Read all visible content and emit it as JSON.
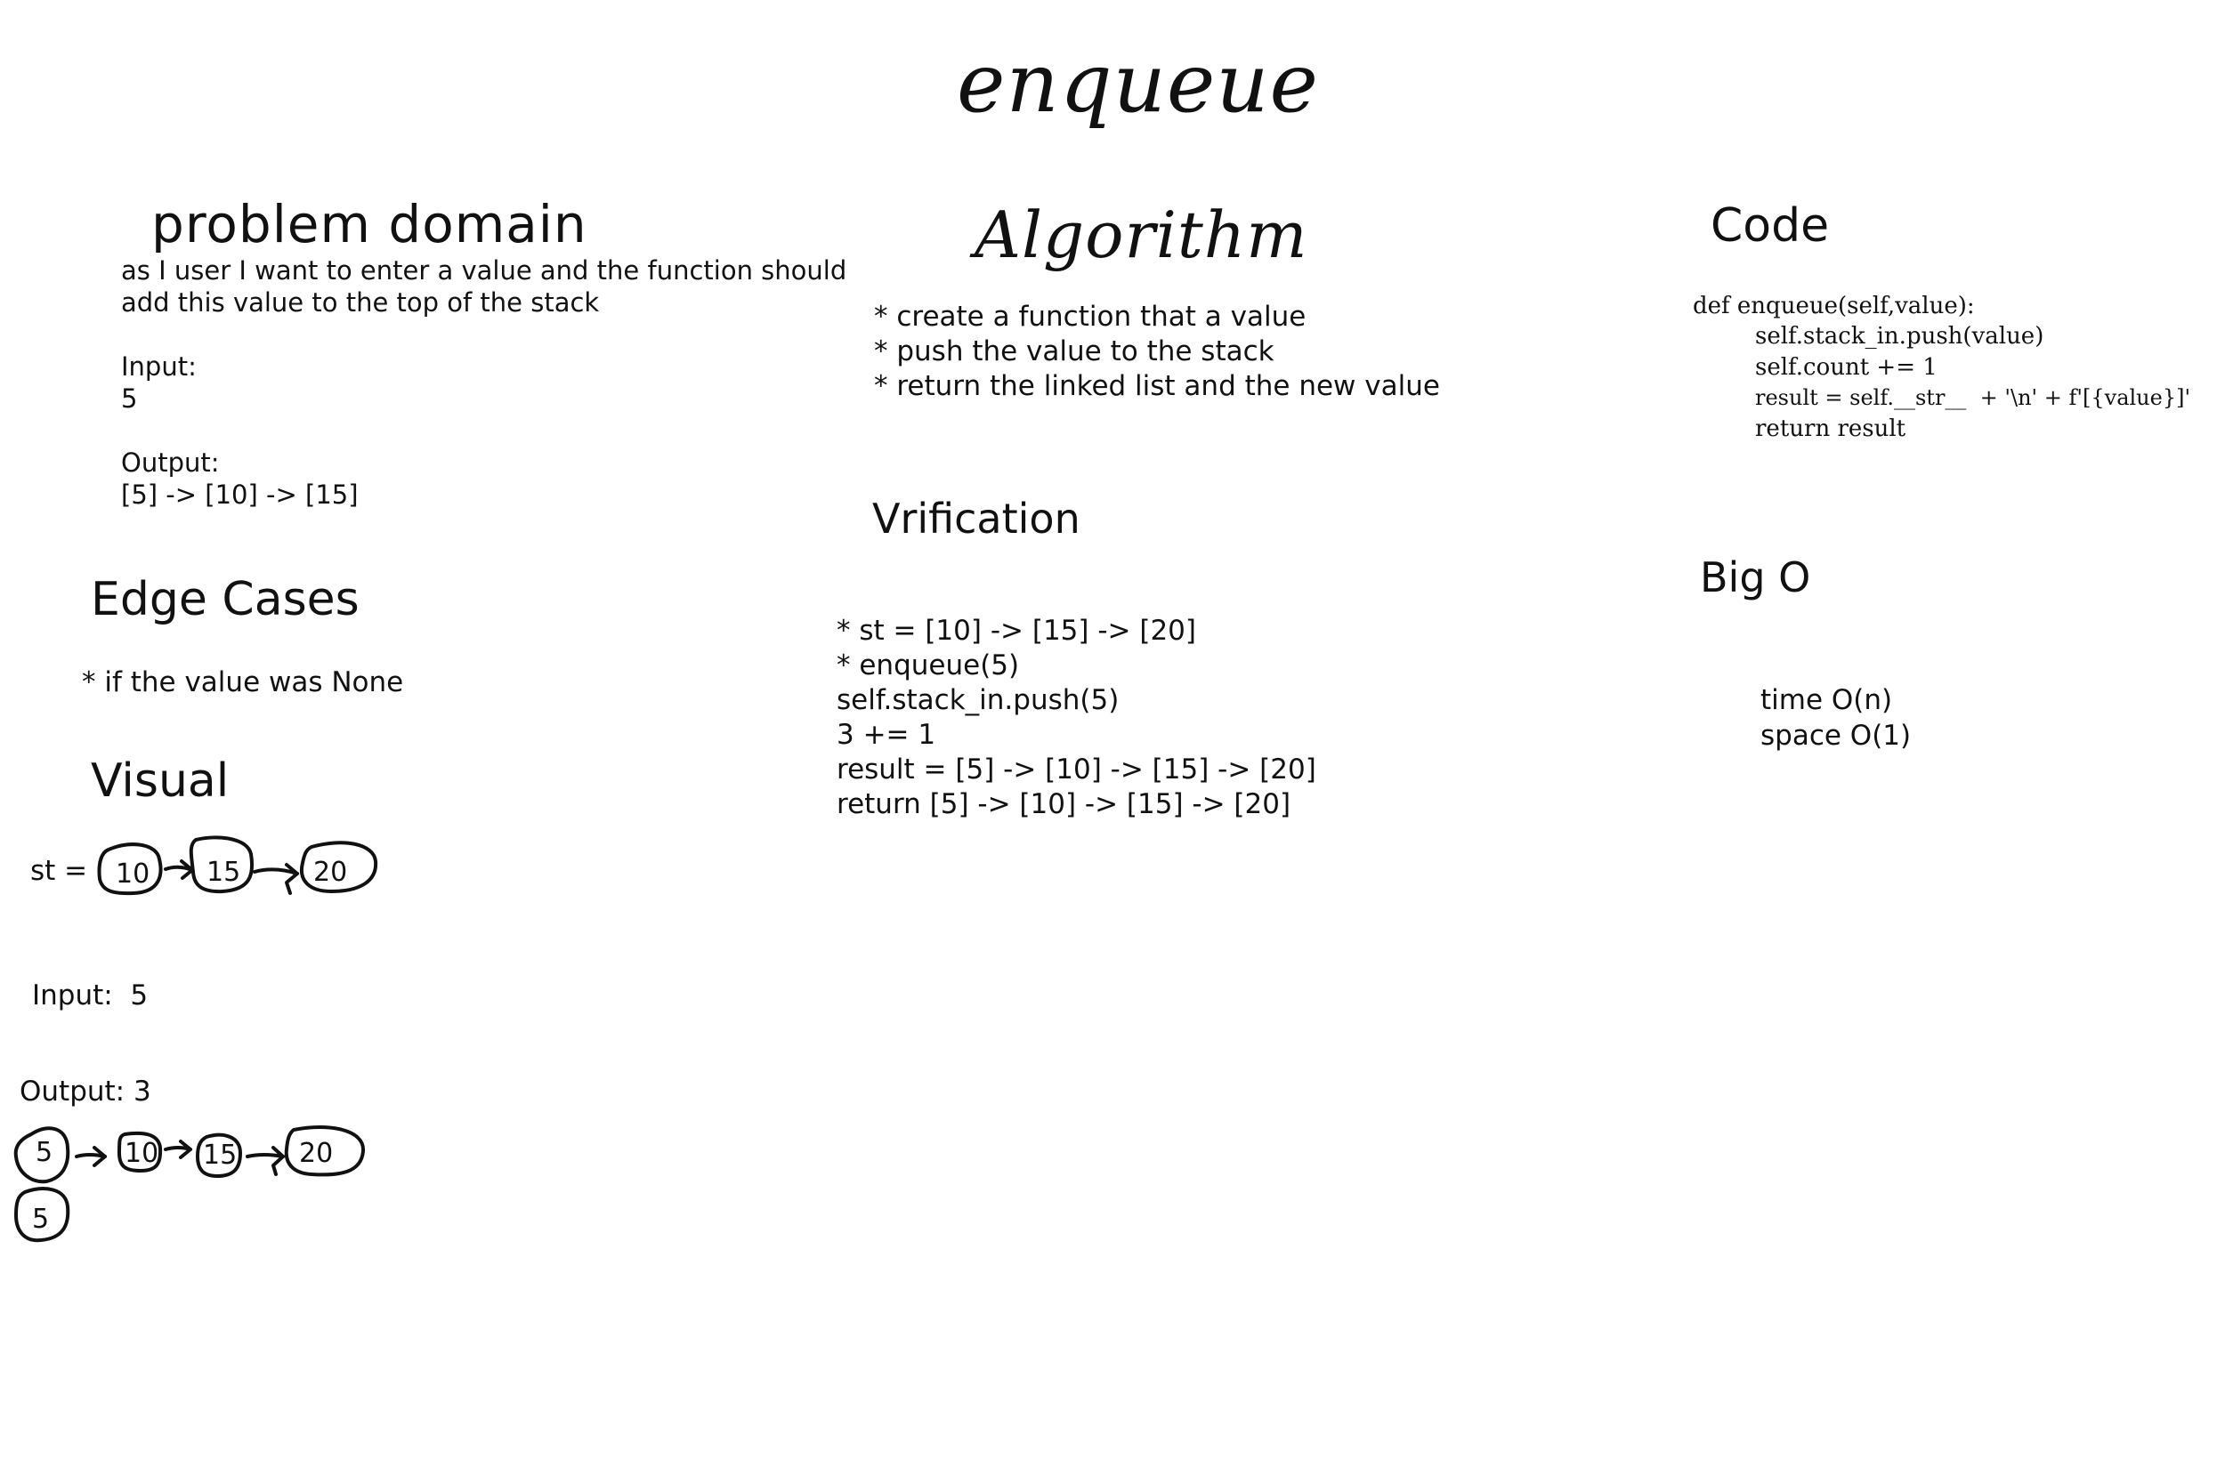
{
  "title": "enqueue",
  "problem_domain": {
    "heading": "problem domain",
    "description": [
      "as I user I want to enter a value and the function should",
      "add this value to the top of the stack"
    ],
    "input_label": "Input:",
    "input_value": "5",
    "output_label": "Output:",
    "output_value": "[5] -> [10] -> [15]"
  },
  "edge_cases": {
    "heading": "Edge Cases",
    "items": [
      "* if the value was None"
    ]
  },
  "visual": {
    "heading": "Visual",
    "st_label": "st =",
    "st_nodes": [
      "10",
      "15",
      "20"
    ],
    "input_text": "Input:  5",
    "output_text": "Output: 3",
    "output_nodes": [
      "5",
      "10",
      "15",
      "20"
    ],
    "extra_node": "5"
  },
  "algorithm": {
    "heading": "Algorithm",
    "steps": [
      "* create a function that a value",
      "* push the value to the stack",
      "* return the linked list and the new value"
    ]
  },
  "verification": {
    "heading": "Vrification",
    "lines": [
      "* st = [10] -> [15] -> [20]",
      "* enqueue(5)",
      "self.stack_in.push(5)",
      "3 += 1",
      "result = [5] -> [10] -> [15] -> [20]",
      "return [5] -> [10] -> [15] -> [20]"
    ]
  },
  "code": {
    "heading": "Code",
    "lines": [
      "def enqueue(self,value):",
      "self.stack_in.push(value)",
      "self.count += 1",
      "result = self.__str__  + '\\n' + f'[{value}]'",
      "return result"
    ]
  },
  "big_o": {
    "heading": "Big O",
    "time": "time O(n)",
    "space": "space O(1)"
  }
}
